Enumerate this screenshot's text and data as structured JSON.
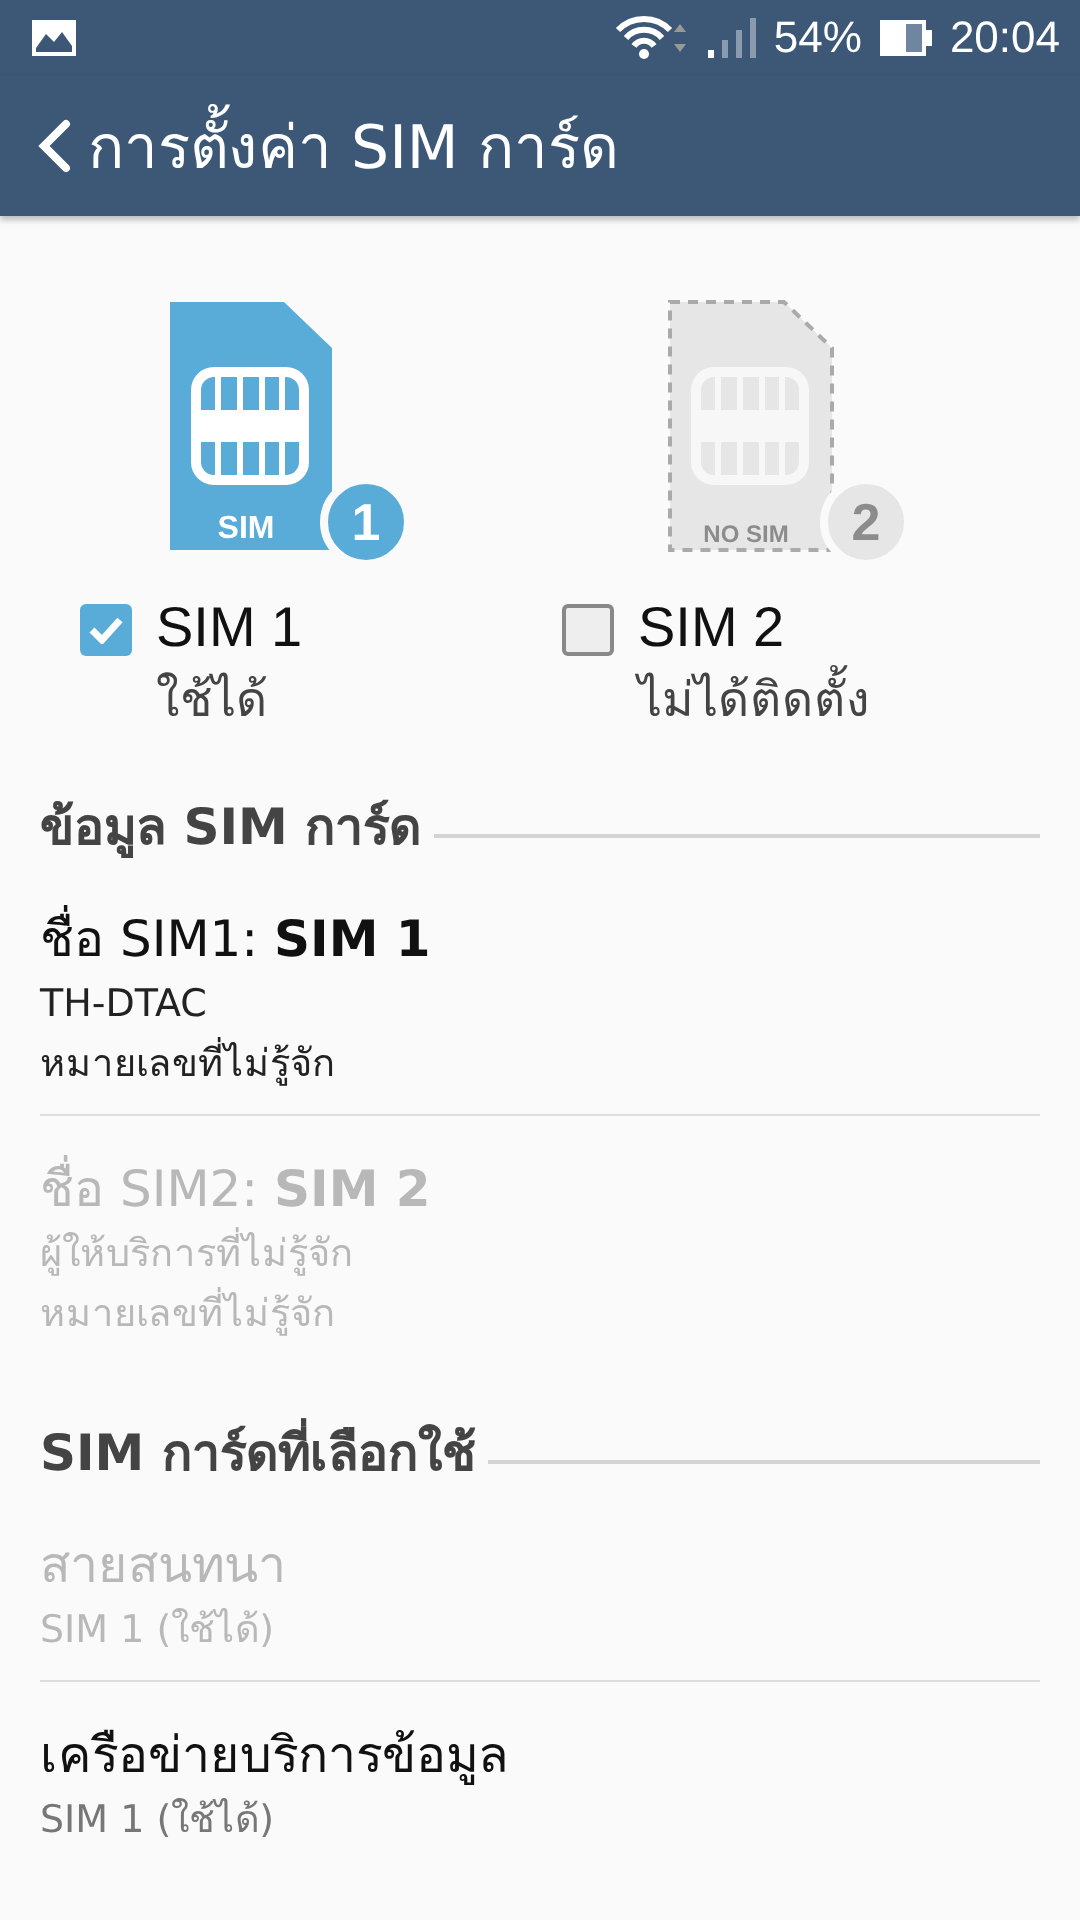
{
  "status_bar": {
    "battery": "54%",
    "time": "20:04"
  },
  "title_bar": {
    "title": "การตั้งค่า SIM การ์ด"
  },
  "sim_cards": [
    {
      "card_label": "SIM",
      "number": "1",
      "name": "SIM 1",
      "status": "ใช้ได้",
      "checked": true,
      "inserted": true
    },
    {
      "card_label": "NO SIM",
      "number": "2",
      "name": "SIM 2",
      "status": "ไม่ได้ติดตั้ง",
      "checked": false,
      "inserted": false
    }
  ],
  "sections": [
    {
      "title": "ข้อมูล SIM การ์ด",
      "kind": "info",
      "items": [
        {
          "title": "ชื่อ SIM1: **SIM 1**",
          "lines": [
            "TH-DTAC",
            "หมายเลขที่ไม่รู้จัก"
          ],
          "disabled": false
        },
        {
          "title": "ชื่อ SIM2: **SIM 2**",
          "lines": [
            "ผู้ให้บริการที่ไม่รู้จัก",
            "หมายเลขที่ไม่รู้จัก"
          ],
          "disabled": true
        }
      ]
    },
    {
      "title": "SIM การ์ดที่เลือกใช้",
      "kind": "choice",
      "items": [
        {
          "title": "สายสนทนา",
          "lines": [
            "SIM 1 (ใช้ได้)"
          ],
          "disabled": true
        },
        {
          "title": "เครือข่ายบริการข้อมูล",
          "lines": [
            "SIM 1 (ใช้ได้)"
          ],
          "disabled": false
        }
      ]
    }
  ]
}
